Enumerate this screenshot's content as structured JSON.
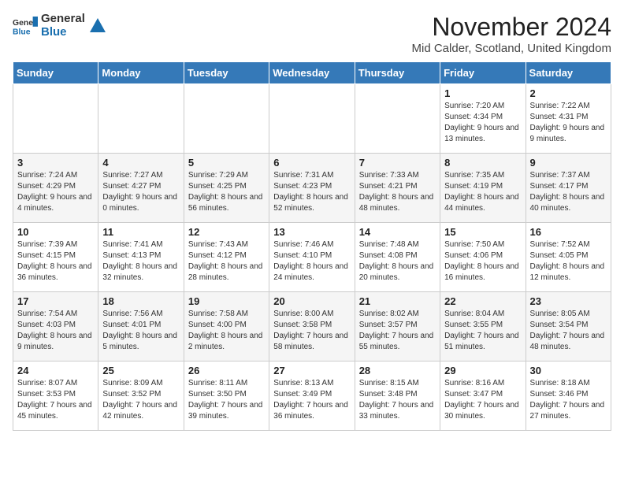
{
  "logo": {
    "general": "General",
    "blue": "Blue"
  },
  "title": "November 2024",
  "location": "Mid Calder, Scotland, United Kingdom",
  "days_of_week": [
    "Sunday",
    "Monday",
    "Tuesday",
    "Wednesday",
    "Thursday",
    "Friday",
    "Saturday"
  ],
  "weeks": [
    [
      {
        "day": "",
        "info": ""
      },
      {
        "day": "",
        "info": ""
      },
      {
        "day": "",
        "info": ""
      },
      {
        "day": "",
        "info": ""
      },
      {
        "day": "",
        "info": ""
      },
      {
        "day": "1",
        "info": "Sunrise: 7:20 AM\nSunset: 4:34 PM\nDaylight: 9 hours and 13 minutes."
      },
      {
        "day": "2",
        "info": "Sunrise: 7:22 AM\nSunset: 4:31 PM\nDaylight: 9 hours and 9 minutes."
      }
    ],
    [
      {
        "day": "3",
        "info": "Sunrise: 7:24 AM\nSunset: 4:29 PM\nDaylight: 9 hours and 4 minutes."
      },
      {
        "day": "4",
        "info": "Sunrise: 7:27 AM\nSunset: 4:27 PM\nDaylight: 9 hours and 0 minutes."
      },
      {
        "day": "5",
        "info": "Sunrise: 7:29 AM\nSunset: 4:25 PM\nDaylight: 8 hours and 56 minutes."
      },
      {
        "day": "6",
        "info": "Sunrise: 7:31 AM\nSunset: 4:23 PM\nDaylight: 8 hours and 52 minutes."
      },
      {
        "day": "7",
        "info": "Sunrise: 7:33 AM\nSunset: 4:21 PM\nDaylight: 8 hours and 48 minutes."
      },
      {
        "day": "8",
        "info": "Sunrise: 7:35 AM\nSunset: 4:19 PM\nDaylight: 8 hours and 44 minutes."
      },
      {
        "day": "9",
        "info": "Sunrise: 7:37 AM\nSunset: 4:17 PM\nDaylight: 8 hours and 40 minutes."
      }
    ],
    [
      {
        "day": "10",
        "info": "Sunrise: 7:39 AM\nSunset: 4:15 PM\nDaylight: 8 hours and 36 minutes."
      },
      {
        "day": "11",
        "info": "Sunrise: 7:41 AM\nSunset: 4:13 PM\nDaylight: 8 hours and 32 minutes."
      },
      {
        "day": "12",
        "info": "Sunrise: 7:43 AM\nSunset: 4:12 PM\nDaylight: 8 hours and 28 minutes."
      },
      {
        "day": "13",
        "info": "Sunrise: 7:46 AM\nSunset: 4:10 PM\nDaylight: 8 hours and 24 minutes."
      },
      {
        "day": "14",
        "info": "Sunrise: 7:48 AM\nSunset: 4:08 PM\nDaylight: 8 hours and 20 minutes."
      },
      {
        "day": "15",
        "info": "Sunrise: 7:50 AM\nSunset: 4:06 PM\nDaylight: 8 hours and 16 minutes."
      },
      {
        "day": "16",
        "info": "Sunrise: 7:52 AM\nSunset: 4:05 PM\nDaylight: 8 hours and 12 minutes."
      }
    ],
    [
      {
        "day": "17",
        "info": "Sunrise: 7:54 AM\nSunset: 4:03 PM\nDaylight: 8 hours and 9 minutes."
      },
      {
        "day": "18",
        "info": "Sunrise: 7:56 AM\nSunset: 4:01 PM\nDaylight: 8 hours and 5 minutes."
      },
      {
        "day": "19",
        "info": "Sunrise: 7:58 AM\nSunset: 4:00 PM\nDaylight: 8 hours and 2 minutes."
      },
      {
        "day": "20",
        "info": "Sunrise: 8:00 AM\nSunset: 3:58 PM\nDaylight: 7 hours and 58 minutes."
      },
      {
        "day": "21",
        "info": "Sunrise: 8:02 AM\nSunset: 3:57 PM\nDaylight: 7 hours and 55 minutes."
      },
      {
        "day": "22",
        "info": "Sunrise: 8:04 AM\nSunset: 3:55 PM\nDaylight: 7 hours and 51 minutes."
      },
      {
        "day": "23",
        "info": "Sunrise: 8:05 AM\nSunset: 3:54 PM\nDaylight: 7 hours and 48 minutes."
      }
    ],
    [
      {
        "day": "24",
        "info": "Sunrise: 8:07 AM\nSunset: 3:53 PM\nDaylight: 7 hours and 45 minutes."
      },
      {
        "day": "25",
        "info": "Sunrise: 8:09 AM\nSunset: 3:52 PM\nDaylight: 7 hours and 42 minutes."
      },
      {
        "day": "26",
        "info": "Sunrise: 8:11 AM\nSunset: 3:50 PM\nDaylight: 7 hours and 39 minutes."
      },
      {
        "day": "27",
        "info": "Sunrise: 8:13 AM\nSunset: 3:49 PM\nDaylight: 7 hours and 36 minutes."
      },
      {
        "day": "28",
        "info": "Sunrise: 8:15 AM\nSunset: 3:48 PM\nDaylight: 7 hours and 33 minutes."
      },
      {
        "day": "29",
        "info": "Sunrise: 8:16 AM\nSunset: 3:47 PM\nDaylight: 7 hours and 30 minutes."
      },
      {
        "day": "30",
        "info": "Sunrise: 8:18 AM\nSunset: 3:46 PM\nDaylight: 7 hours and 27 minutes."
      }
    ]
  ]
}
